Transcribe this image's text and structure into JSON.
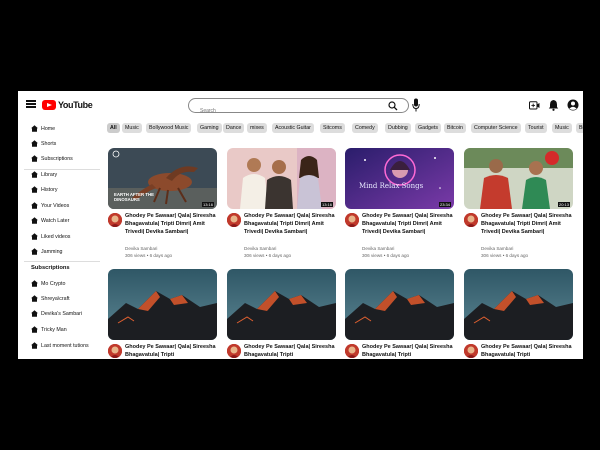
{
  "header": {
    "logo_text": "YouTube",
    "search_placeholder": "Search"
  },
  "sidebar": {
    "items": [
      {
        "label": "Home"
      },
      {
        "label": "Shorts"
      },
      {
        "label": "Subscriptions"
      },
      {
        "label": "Library"
      },
      {
        "label": "History"
      },
      {
        "label": "Your Videos"
      },
      {
        "label": "Watch Later"
      },
      {
        "label": "Liked videos"
      },
      {
        "label": "Jamming"
      }
    ],
    "subscriptions_heading": "Subscriptions",
    "subscriptions": [
      {
        "label": "Mo Crypto"
      },
      {
        "label": "Shreya\\craft"
      },
      {
        "label": "Devika's Sambari"
      },
      {
        "label": "Tricky Man"
      },
      {
        "label": "Last moment tutions"
      }
    ]
  },
  "chips": [
    "All",
    "Music",
    "Bollywood Music",
    "Gaming",
    "Dance",
    "mixes",
    "Acoustic Guitar",
    "Sitcoms",
    "Comedy",
    "Dubbing",
    "Gadgets",
    "Bitcoin",
    "Computer Science",
    "Tourist",
    "Music",
    "Bi"
  ],
  "videos": [
    {
      "title": "Ghodey Pe Sawaar| Qala| Sireesha Bhagavatula| Tripti Dimri| Amit Trivedi| Devika Sambari|",
      "channel": "Devika Sambari",
      "meta": "306 views • 6 days ago",
      "duration": "13:16",
      "overlay": "EARTH AFTER THE DINOSAURS"
    },
    {
      "title": "Ghodey Pe Sawaar| Qala| Sireesha Bhagavatula| Tripti Dimri| Amit Trivedi| Devika Sambari|",
      "channel": "Devika Sambari",
      "meta": "306 views • 6 days ago",
      "duration": "13:16"
    },
    {
      "title": "Ghodey Pe Sawaar| Qala| Sireesha Bhagavatula| Tripti Dimri| Amit Trivedi| Devika Sambari|",
      "channel": "Devika Sambari",
      "meta": "306 views • 6 days ago",
      "duration": "23:34",
      "overlay": "Mind Relax Songs"
    },
    {
      "title": "Ghodey Pe Sawaar| Qala| Sireesha Bhagavatula| Tripti Dimri| Amit Trivedi| Devika Sambari|",
      "channel": "Devika Sambari",
      "meta": "306 views • 6 days ago",
      "duration": "20:13"
    },
    {
      "title": "Ghodey Pe Sawaar| Qala| Sireesha Bhagavatula| Tripti",
      "channel": "",
      "meta": "",
      "duration": ""
    },
    {
      "title": "Ghodey Pe Sawaar| Qala| Sireesha Bhagavatula| Tripti",
      "channel": "",
      "meta": "",
      "duration": ""
    },
    {
      "title": "Ghodey Pe Sawaar| Qala| Sireesha Bhagavatula| Tripti",
      "channel": "",
      "meta": "",
      "duration": ""
    },
    {
      "title": "Ghodey Pe Sawaar| Qala| Sireesha Bhagavatula| Tripti",
      "channel": "",
      "meta": "",
      "duration": ""
    }
  ]
}
